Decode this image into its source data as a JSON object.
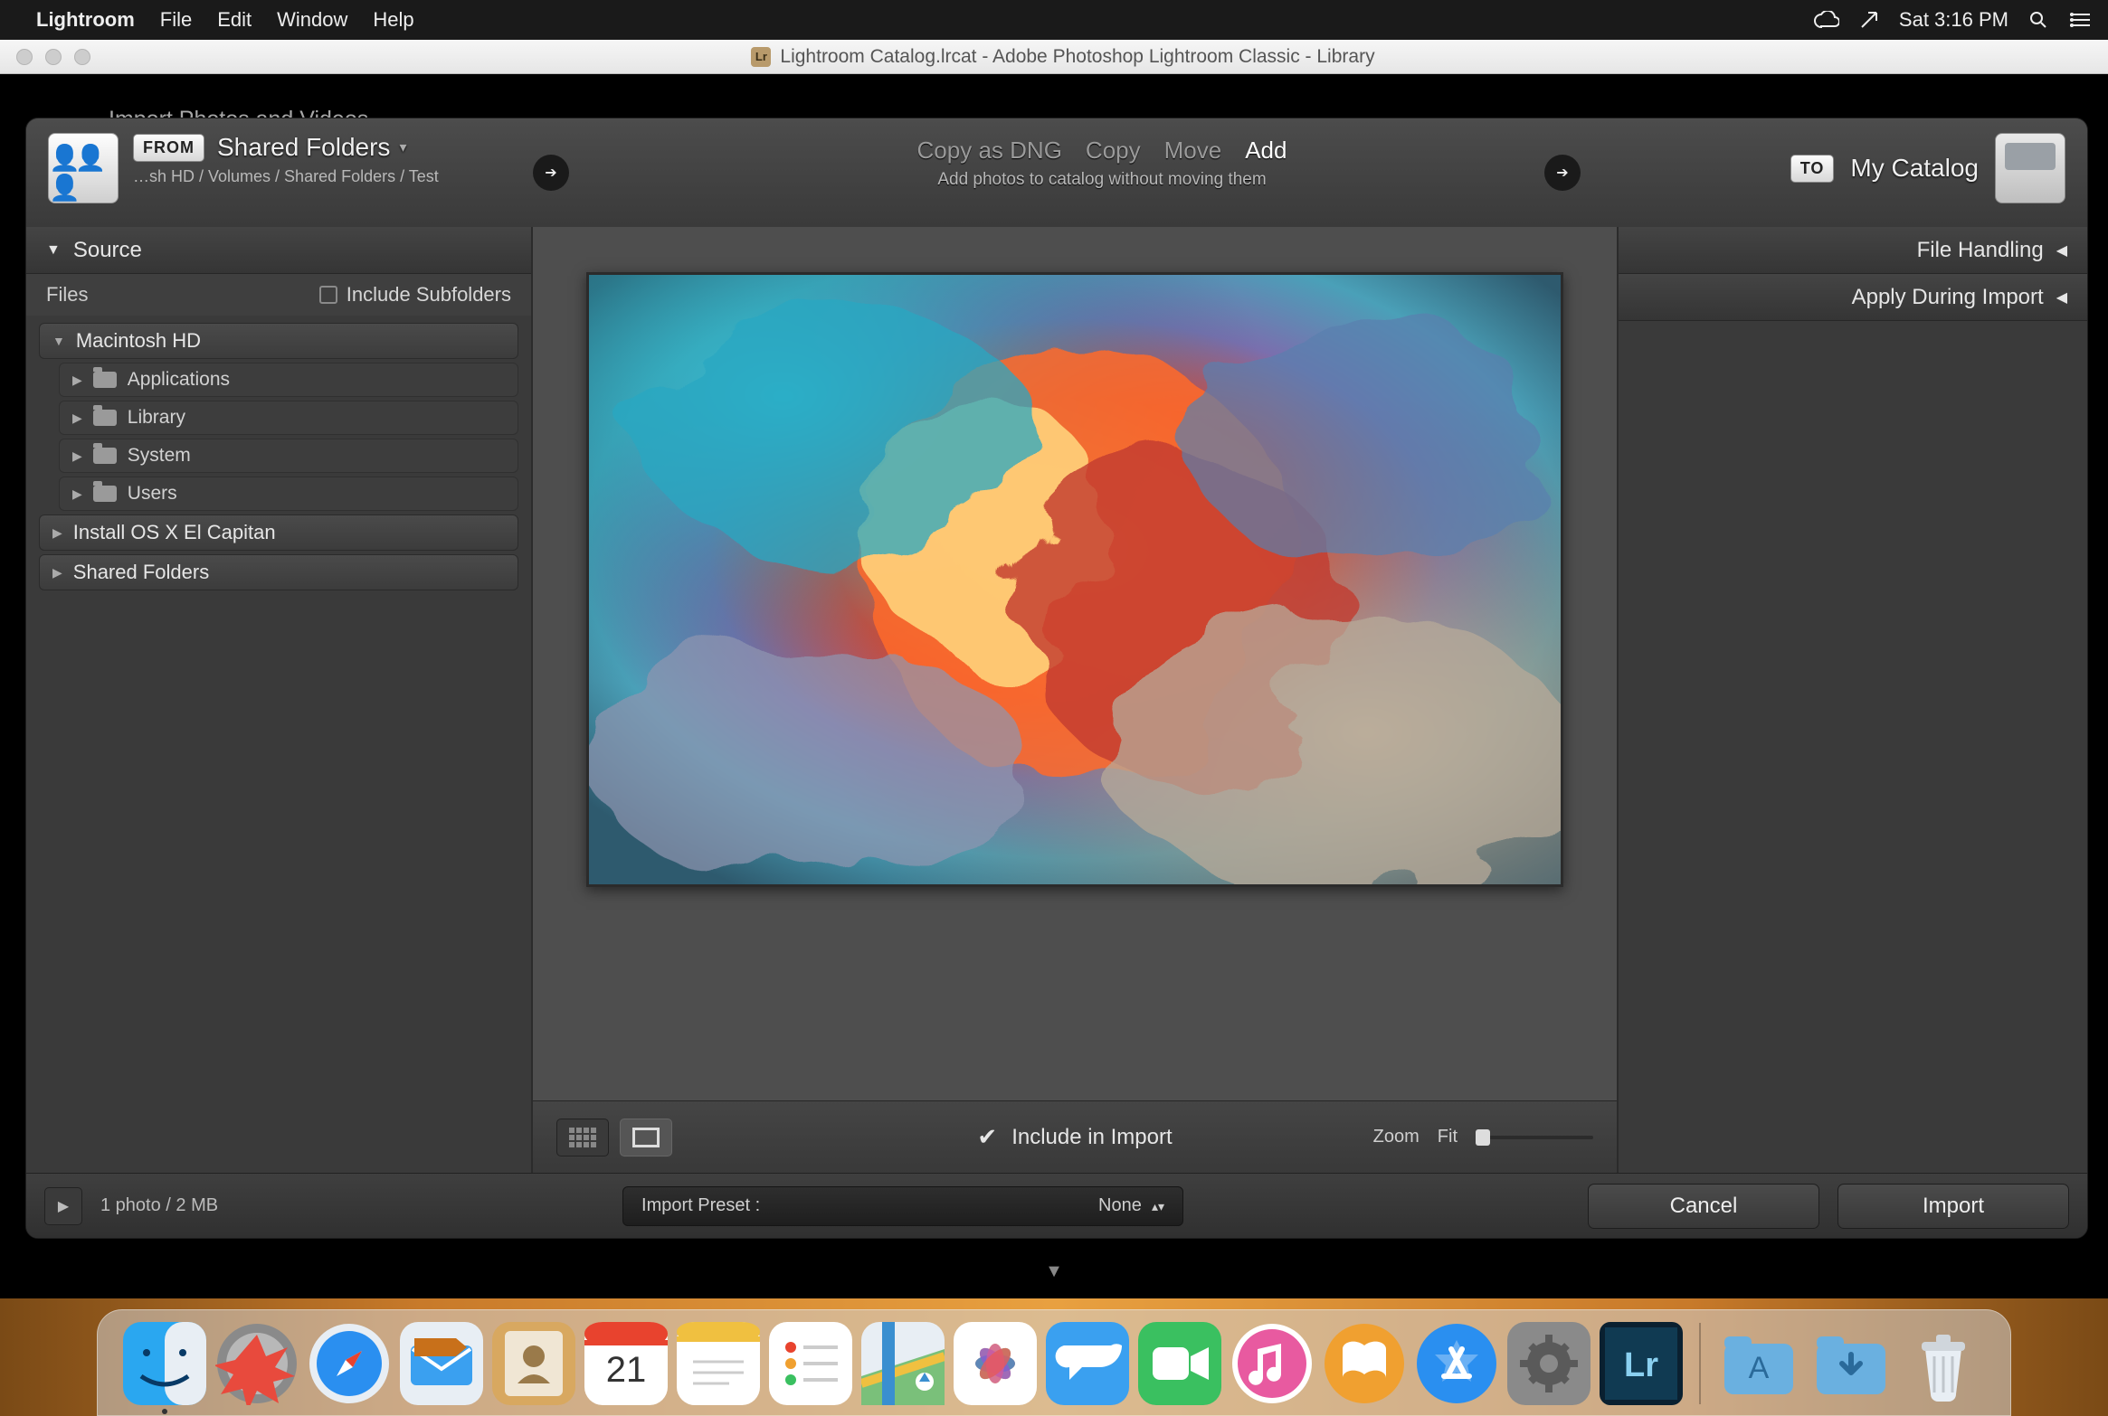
{
  "menubar": {
    "app": "Lightroom",
    "items": [
      "File",
      "Edit",
      "Window",
      "Help"
    ],
    "clock": "Sat 3:16 PM"
  },
  "window_title": "Lightroom Catalog.lrcat - Adobe Photoshop Lightroom Classic - Library",
  "behind_dialog_text": "Import Photos and Videos",
  "dialog": {
    "from_label": "FROM",
    "to_label": "TO",
    "source_name": "Shared Folders",
    "source_path": "…sh HD / Volumes / Shared Folders / Test",
    "dest_name": "My Catalog",
    "modes": {
      "copy_dng": "Copy as DNG",
      "copy": "Copy",
      "move": "Move",
      "add": "Add"
    },
    "modes_subtitle": "Add photos to catalog without moving them"
  },
  "left_panel": {
    "header": "Source",
    "files_label": "Files",
    "include_subfolders": "Include Subfolders",
    "volumes": [
      {
        "name": "Macintosh HD",
        "expanded": true,
        "children": [
          "Applications",
          "Library",
          "System",
          "Users"
        ]
      },
      {
        "name": "Install OS X El Capitan",
        "expanded": false,
        "children": []
      },
      {
        "name": "Shared Folders",
        "expanded": false,
        "children": []
      }
    ]
  },
  "right_panel": {
    "headers": [
      "File Handling",
      "Apply During Import"
    ]
  },
  "center": {
    "include_in_import": "Include in Import",
    "zoom_label": "Zoom",
    "fit_label": "Fit"
  },
  "footer": {
    "info": "1 photo / 2 MB",
    "preset_label": "Import Preset :",
    "preset_value": "None",
    "cancel": "Cancel",
    "import": "Import"
  },
  "dock": {
    "apps": [
      "finder",
      "launchpad",
      "safari",
      "mail",
      "contacts",
      "calendar",
      "notes",
      "reminders",
      "messages-alt",
      "photos",
      "messages",
      "facetime",
      "itunes",
      "ibooks",
      "appstore",
      "preferences",
      "lightroom"
    ],
    "calendar_day": "21",
    "right": [
      "folder-apps",
      "folder-downloads",
      "trash"
    ]
  }
}
